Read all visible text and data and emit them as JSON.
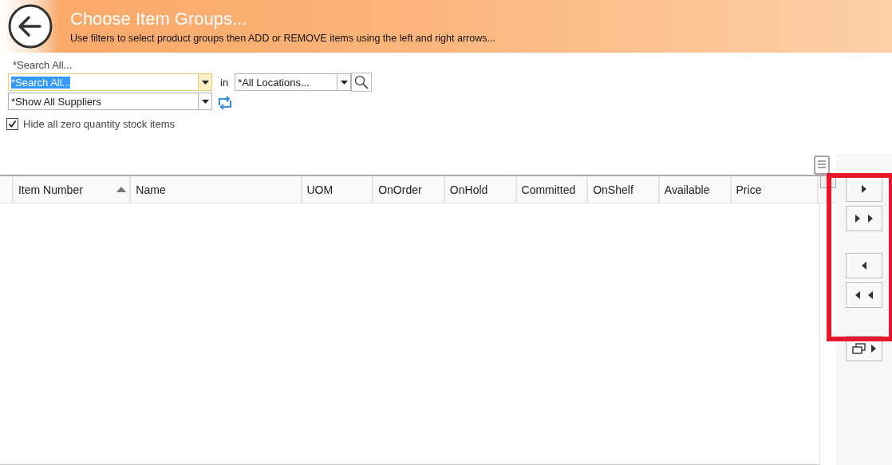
{
  "header": {
    "title": "Choose Item Groups...",
    "subtitle": "Use filters to select product groups then ADD or REMOVE items using the left and right arrows..."
  },
  "filters": {
    "search_label": "*Search All...",
    "search": {
      "value": "*Search All...",
      "text_selected": true
    },
    "in_label": "in",
    "location": {
      "value": "*All Locations..."
    },
    "supplier": {
      "value": "*Show All Suppliers"
    },
    "hide_zero": {
      "label": "Hide all zero quantity stock items",
      "checked": true
    }
  },
  "table": {
    "columns": [
      {
        "label": "Item Number",
        "sorted": true
      },
      {
        "label": "Name",
        "sorted": false
      },
      {
        "label": "UOM",
        "sorted": false
      },
      {
        "label": "OnOrder",
        "sorted": false
      },
      {
        "label": "OnHold",
        "sorted": false
      },
      {
        "label": "Committed",
        "sorted": false
      },
      {
        "label": "OnShelf",
        "sorted": false
      },
      {
        "label": "Available",
        "sorted": false
      },
      {
        "label": "Price",
        "sorted": false
      }
    ]
  },
  "side_buttons": [
    {
      "kind": "add"
    },
    {
      "kind": "add_all"
    },
    {
      "kind": "remove"
    },
    {
      "kind": "remove_all"
    },
    {
      "kind": "popout"
    }
  ]
}
